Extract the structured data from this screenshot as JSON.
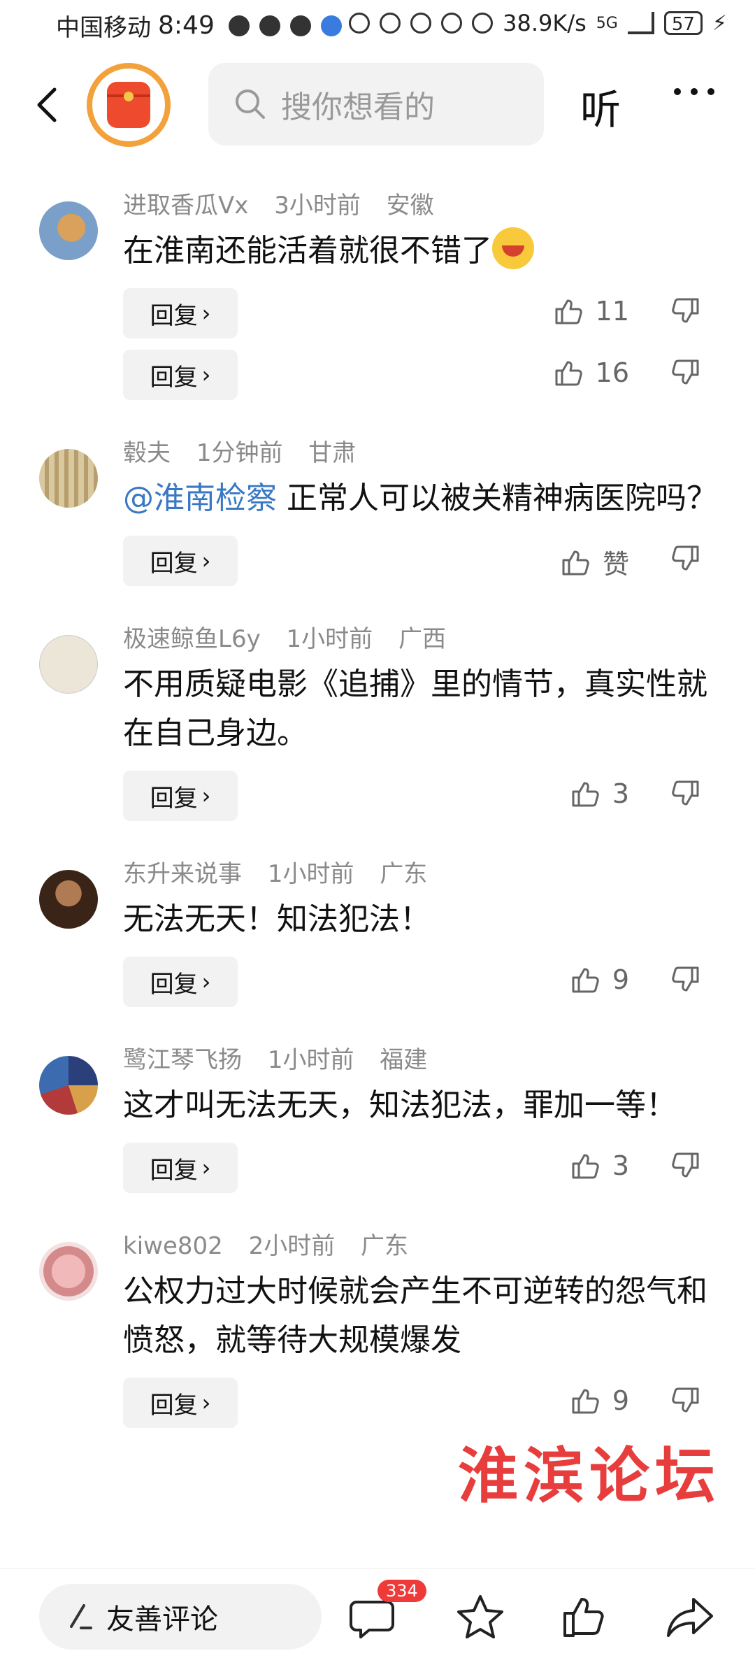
{
  "status_bar": {
    "carrier": "中国移动",
    "time": "8:49",
    "net_speed": "38.9K/s",
    "network": "5G",
    "battery": "57"
  },
  "nav": {
    "search_placeholder": "搜你想看的",
    "listen_label": "听"
  },
  "comments": [
    {
      "user": "进取香瓜Vx",
      "time": "3小时前",
      "region": "安徽",
      "text": "在淮南还能活着就很不错了",
      "has_emoji": true,
      "replies": [
        {
          "reply_label": "回复",
          "likes": "11"
        },
        {
          "reply_label": "回复",
          "likes": "16"
        }
      ]
    },
    {
      "user": "毂夫",
      "time": "1分钟前",
      "region": "甘肃",
      "mention": "@淮南检察",
      "text": " 正常人可以被关精神病医院吗？",
      "replies": [
        {
          "reply_label": "回复",
          "likes": "赞"
        }
      ]
    },
    {
      "user": "极速鲸鱼L6y",
      "time": "1小时前",
      "region": "广西",
      "text": "不用质疑电影《追捕》里的情节，真实性就在自己身边。",
      "replies": [
        {
          "reply_label": "回复",
          "likes": "3"
        }
      ]
    },
    {
      "user": "东升来说事",
      "time": "1小时前",
      "region": "广东",
      "text": "无法无天！知法犯法！",
      "replies": [
        {
          "reply_label": "回复",
          "likes": "9"
        }
      ]
    },
    {
      "user": "鹭江琴飞扬",
      "time": "1小时前",
      "region": "福建",
      "text": "这才叫无法无天，知法犯法，罪加一等！",
      "replies": [
        {
          "reply_label": "回复",
          "likes": "3"
        }
      ]
    },
    {
      "user": "kiwe802",
      "time": "2小时前",
      "region": "广东",
      "text": "公权力过大时候就会产生不可逆转的怨气和愤怒，就等待大规模爆发",
      "replies": [
        {
          "reply_label": "回复",
          "likes": "9"
        }
      ]
    }
  ],
  "watermark": "淮滨论坛",
  "bottom_bar": {
    "input_label": "友善评论",
    "comment_count": "334"
  },
  "colors": {
    "mention": "#3a78c4",
    "badge": "#ef3a3a",
    "watermark": "#e62828"
  }
}
